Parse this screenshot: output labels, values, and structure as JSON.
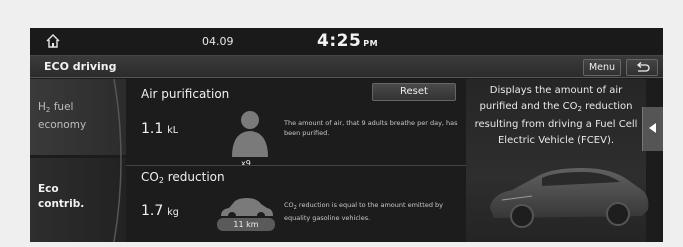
{
  "statusbar": {
    "home_icon": "home-icon",
    "date": "04.09",
    "time": "4:25",
    "ampm": "PM"
  },
  "titlebar": {
    "title": "ECO driving",
    "menu_label": "Menu",
    "back_icon": "back-arrow-icon"
  },
  "sidebar": {
    "items": [
      {
        "label_prefix": "H",
        "label_sub": "2",
        "label_suffix": " fuel",
        "label_line2": "economy",
        "selected": false
      },
      {
        "label_line1": "Eco",
        "label_line2": "contrib.",
        "selected": true
      }
    ]
  },
  "air_purification": {
    "title": "Air purification",
    "reset_label": "Reset",
    "value": "1.1",
    "unit": "kL",
    "badge": "x9",
    "icon": "person-icon",
    "description": "The amount of air, that 9 adults breathe per day, has been purified."
  },
  "co2_reduction": {
    "title_prefix": "CO",
    "title_sub": "2",
    "title_suffix": " reduction",
    "value": "1.7",
    "unit": "kg",
    "icon": "car-icon",
    "badge": "11 km",
    "description_prefix": "CO",
    "description_sub": "2",
    "description_suffix": " reduction is equal to the amount emitted by equality gasoline vehicles."
  },
  "info_panel": {
    "text_line1": "Displays the amount of air",
    "text_line2_prefix": "purified and the CO",
    "text_line2_sub": "2",
    "text_line2_suffix": " reduction",
    "text_line3": "resulting from driving a Fuel Cell",
    "text_line4": "Electric Vehicle (FCEV).",
    "collapse_icon": "chevron-left-icon"
  },
  "colors": {
    "screen_bg": "#1c1c1c",
    "text": "#f0f0f0",
    "badge_bg": "#5a5a5a"
  }
}
